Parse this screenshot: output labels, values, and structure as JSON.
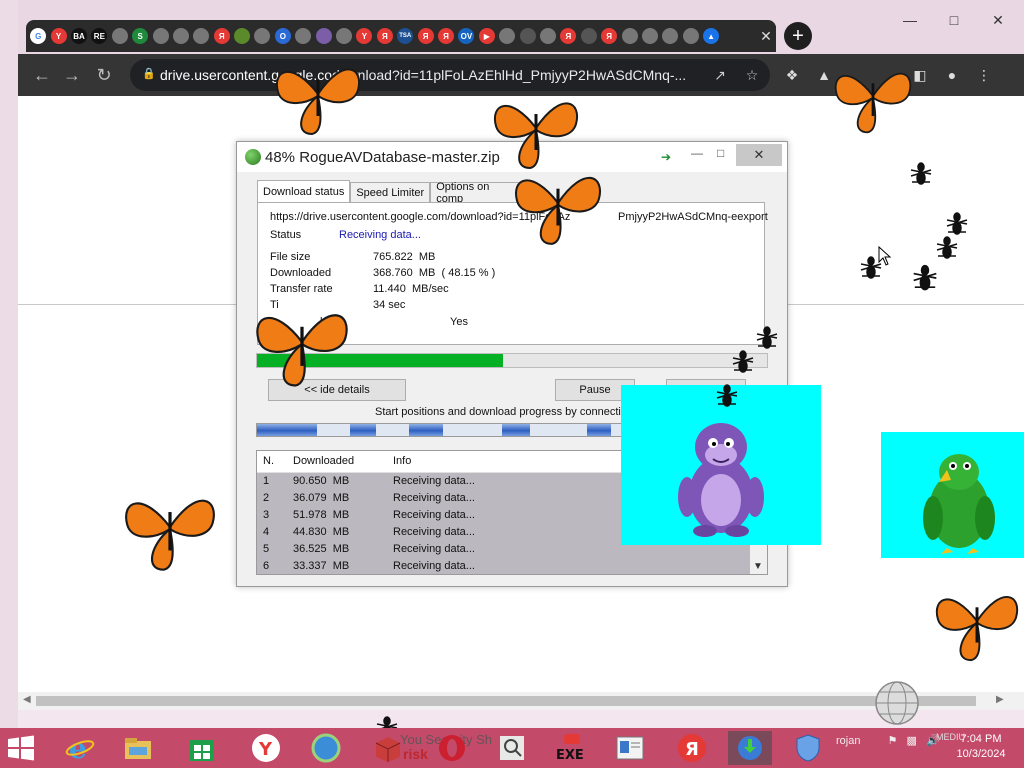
{
  "browser": {
    "favicons": [
      {
        "name": "google-favicon",
        "glyph": "G",
        "color": "#ffffff",
        "fg": "#4285f4"
      },
      {
        "name": "yandex-favicon",
        "glyph": "Y",
        "color": "#e53935"
      },
      {
        "name": "ba-favicon",
        "glyph": "BA",
        "color": "#111111"
      },
      {
        "name": "re-favicon",
        "glyph": "RE",
        "color": "#111111"
      },
      {
        "name": "globe-favicon",
        "glyph": "",
        "color": "#777777"
      },
      {
        "name": "s-favicon",
        "glyph": "S",
        "color": "#1e8a3c"
      },
      {
        "name": "globe-favicon",
        "glyph": "",
        "color": "#777777"
      },
      {
        "name": "globe-favicon",
        "glyph": "",
        "color": "#777777"
      },
      {
        "name": "globe-favicon",
        "glyph": "",
        "color": "#777777"
      },
      {
        "name": "yandex-favicon",
        "glyph": "Я",
        "color": "#e53935"
      },
      {
        "name": "leaf-favicon",
        "glyph": "",
        "color": "#5a8a2a"
      },
      {
        "name": "globe-favicon",
        "glyph": "",
        "color": "#777777"
      },
      {
        "name": "target-favicon",
        "glyph": "O",
        "color": "#2a6ad6"
      },
      {
        "name": "globe-favicon",
        "glyph": "",
        "color": "#777777"
      },
      {
        "name": "photo-favicon",
        "glyph": "",
        "color": "#7b5ea7"
      },
      {
        "name": "globe-favicon",
        "glyph": "",
        "color": "#777777"
      },
      {
        "name": "yandex-favicon",
        "glyph": "Y",
        "color": "#e53935"
      },
      {
        "name": "yandex-favicon",
        "glyph": "Я",
        "color": "#e53935"
      },
      {
        "name": "tsa-favicon",
        "glyph": "TSA",
        "color": "#1d4f91"
      },
      {
        "name": "yandex-favicon",
        "glyph": "Я",
        "color": "#e53935"
      },
      {
        "name": "yandex-favicon",
        "glyph": "Я",
        "color": "#e53935"
      },
      {
        "name": "ov-favicon",
        "glyph": "OV",
        "color": "#1565c0"
      },
      {
        "name": "youtube-favicon",
        "glyph": "▶",
        "color": "#e53935"
      },
      {
        "name": "globe-favicon",
        "glyph": "",
        "color": "#777777"
      },
      {
        "name": "museum-favicon",
        "glyph": "",
        "color": "#555555"
      },
      {
        "name": "globe-favicon",
        "glyph": "",
        "color": "#777777"
      },
      {
        "name": "yandex-favicon",
        "glyph": "Я",
        "color": "#e53935"
      },
      {
        "name": "museum-favicon",
        "glyph": "",
        "color": "#555555"
      },
      {
        "name": "yandex-favicon",
        "glyph": "Я",
        "color": "#e53935"
      },
      {
        "name": "globe-favicon",
        "glyph": "",
        "color": "#777777"
      },
      {
        "name": "globe-favicon",
        "glyph": "",
        "color": "#777777"
      },
      {
        "name": "globe-favicon",
        "glyph": "",
        "color": "#777777"
      },
      {
        "name": "globe-favicon",
        "glyph": "",
        "color": "#777777"
      },
      {
        "name": "drive-favicon",
        "glyph": "▲",
        "color": "#1a73e8"
      }
    ],
    "tab_close": "✕",
    "new_tab": "+",
    "url_host": "drive.usercontent.google.co",
    "url_path": "download?id=11plFoLAzEhlHd_PmjyyP2HwASdCMnq-...",
    "accent": "#00b025"
  },
  "idm": {
    "title": "48% RogueAVDatabase-master.zip",
    "tabs": [
      "Download status",
      "Speed Limiter",
      "Options on comp"
    ],
    "url": "https://drive.usercontent.google.com/download?id=11plFoLAz",
    "url_tail": "PmjyyP2HwASdCMnq-eexport",
    "status_label": "Status",
    "status_value": "Receiving data...",
    "file_size_label": "File size",
    "file_size_value": "765.822  MB",
    "downloaded_label": "Downloaded",
    "downloaded_value": "368.760  MB  ( 48.15 % )",
    "transfer_rate_label": "Transfer rate",
    "transfer_rate_value": "11.440  MB/sec",
    "time_left_label": "Ti",
    "time_left_value": "34 sec",
    "resume_label": "bility",
    "resume_value": "Yes",
    "progress_fraction": 0.4815,
    "details_button": "<< ide details",
    "pause_button": "Pause",
    "start_positions_label": "Start positions and download progress by connectio",
    "table_headers": [
      "N.",
      "Downloaded",
      "Info"
    ],
    "connections": [
      {
        "n": "1",
        "downloaded": "90.650  MB",
        "info": "Receiving data..."
      },
      {
        "n": "2",
        "downloaded": "36.079  MB",
        "info": "Receiving data..."
      },
      {
        "n": "3",
        "downloaded": "51.978  MB",
        "info": "Receiving data..."
      },
      {
        "n": "4",
        "downloaded": "44.830  MB",
        "info": "Receiving data..."
      },
      {
        "n": "5",
        "downloaded": "36.525  MB",
        "info": "Receiving data..."
      },
      {
        "n": "6",
        "downloaded": "33.337  MB",
        "info": "Receiving data..."
      }
    ]
  },
  "taskbar": {
    "overlay_a": "You Security Sh",
    "overlay_b": "risk",
    "exe_label": "EXE",
    "tray_text": "rojan",
    "tray_lang": "MEDIU",
    "time": "7:04 PM",
    "date": "10/3/2024"
  }
}
